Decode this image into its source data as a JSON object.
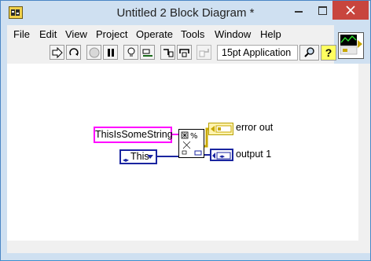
{
  "window": {
    "title": "Untitled 2 Block Diagram *"
  },
  "menu": {
    "items": [
      "File",
      "Edit",
      "View",
      "Project",
      "Operate",
      "Tools",
      "Window",
      "Help"
    ]
  },
  "toolbar": {
    "font_selector": "15pt Application",
    "help_label": "?"
  },
  "diagram": {
    "string_constant": "ThisIsSomeString",
    "enum_constant": "This",
    "indicators": [
      "error out",
      "output 1"
    ]
  },
  "colors": {
    "string_wire": "#ff00ff",
    "enum_wire": "#1a25a0",
    "error_wire": "#c8a800"
  },
  "icons": [
    "run-arrow-icon",
    "run-continuously-icon",
    "abort-icon",
    "pause-icon",
    "highlight-execution-icon",
    "retain-wire-values-icon",
    "step-into-icon",
    "step-over-icon",
    "step-out-icon",
    "search-icon",
    "help-icon"
  ]
}
